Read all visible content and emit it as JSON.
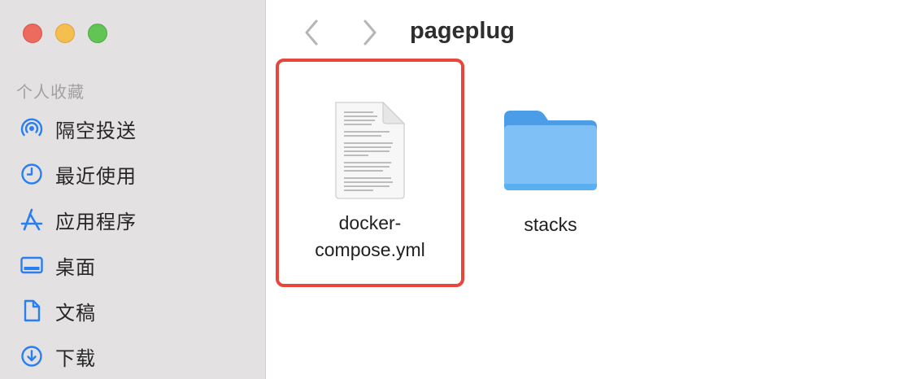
{
  "window": {
    "title": "pageplug",
    "traffic_lights": [
      "close",
      "minimize",
      "zoom"
    ]
  },
  "sidebar": {
    "section_title": "个人收藏",
    "items": [
      {
        "label": "隔空投送",
        "icon": "airdrop-icon"
      },
      {
        "label": "最近使用",
        "icon": "clock-icon"
      },
      {
        "label": "应用程序",
        "icon": "applications-icon"
      },
      {
        "label": "桌面",
        "icon": "desktop-icon"
      },
      {
        "label": "文稿",
        "icon": "document-icon"
      },
      {
        "label": "下载",
        "icon": "download-icon"
      }
    ]
  },
  "files": [
    {
      "name_line1": "docker-",
      "name_line2": "compose.yml",
      "icon": "text-file-icon",
      "highlighted": true
    },
    {
      "name": "stacks",
      "icon": "folder-icon"
    }
  ],
  "colors": {
    "sidebar_bg": "#e3e1e2",
    "accent_blue": "#2a7ff0",
    "highlight_red": "#e8463a",
    "folder_blue": "#5aaff0"
  }
}
